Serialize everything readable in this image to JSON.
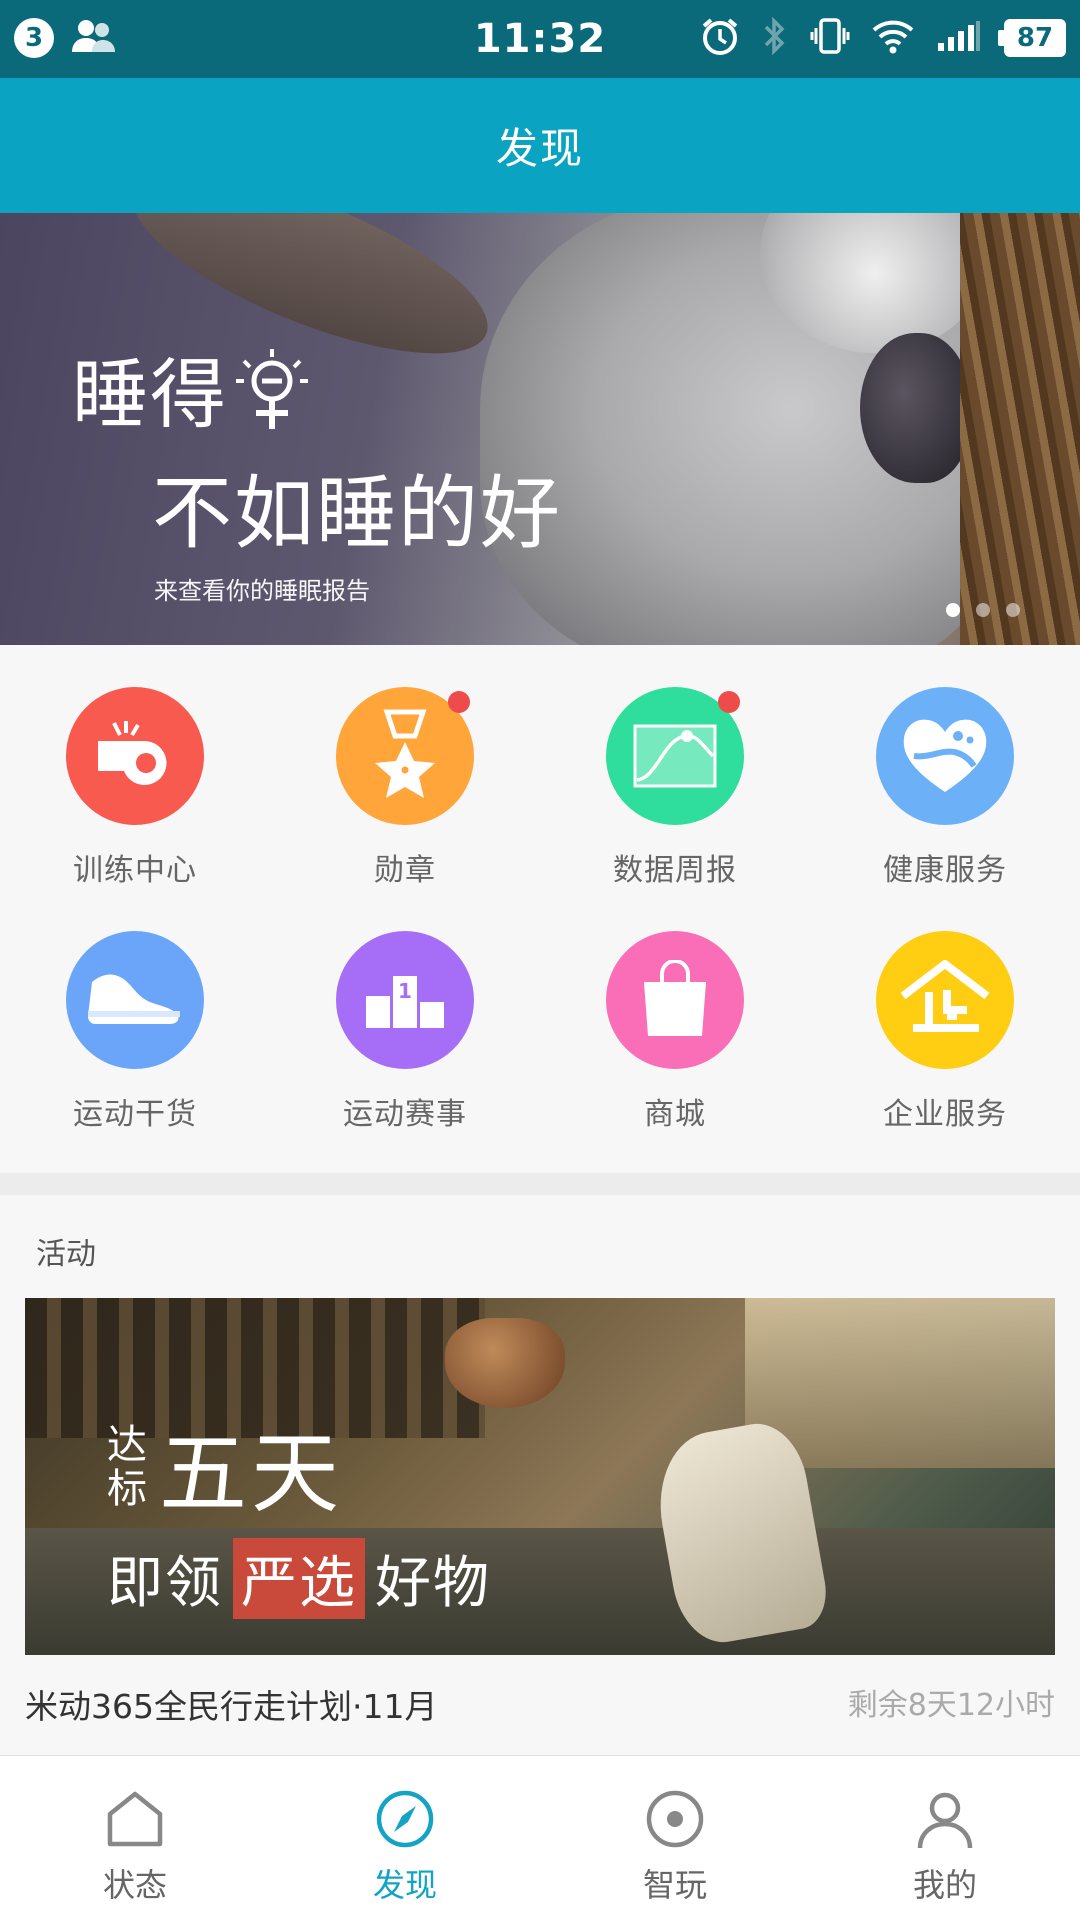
{
  "status_bar": {
    "notification_count": "3",
    "time": "11:32",
    "battery": "87",
    "icons": [
      "contacts-icon",
      "alarm-icon",
      "bluetooth-icon",
      "vibrate-icon",
      "wifi-icon",
      "signal-icon",
      "battery-icon"
    ]
  },
  "header": {
    "title": "发现"
  },
  "banner": {
    "line1": "睡得早",
    "line1_text": "睡得",
    "line2": "不如睡的好",
    "subtitle": "来查看你的睡眠报告",
    "page_count": 3,
    "active_page": 0
  },
  "grid": {
    "items": [
      {
        "label": "训练中心",
        "icon": "whistle-icon",
        "color": "#f85a4f",
        "badge": false
      },
      {
        "label": "勋章",
        "icon": "medal-icon",
        "color": "#ffa53a",
        "badge": true
      },
      {
        "label": "数据周报",
        "icon": "chart-icon",
        "color": "#2fdd9c",
        "badge": true
      },
      {
        "label": "健康服务",
        "icon": "heart-icon",
        "color": "#6cb1f7",
        "badge": false
      },
      {
        "label": "运动干货",
        "icon": "shoe-icon",
        "color": "#6aa5fa",
        "badge": false
      },
      {
        "label": "运动赛事",
        "icon": "podium-icon",
        "color": "#a66ef7",
        "badge": false
      },
      {
        "label": "商城",
        "icon": "shopping-bag-icon",
        "color": "#fa6eb7",
        "badge": false
      },
      {
        "label": "企业服务",
        "icon": "enterprise-icon",
        "color": "#ffcd12",
        "badge": false
      }
    ],
    "badge_color": "#ee4b4b"
  },
  "activity": {
    "section_title": "活动",
    "promo_small_top": "达",
    "promo_small_bottom": "标",
    "promo_big": "五天",
    "promo_line2_a": "即领",
    "promo_line2_hl": "严选",
    "promo_line2_b": "好物",
    "name": "米动365全民行走计划·11月",
    "remaining": "剩余8天12小时"
  },
  "bottom_nav": {
    "items": [
      {
        "label": "状态",
        "icon": "home-icon",
        "active": false
      },
      {
        "label": "发现",
        "icon": "compass-icon",
        "active": true
      },
      {
        "label": "智玩",
        "icon": "radio-target-icon",
        "active": false
      },
      {
        "label": "我的",
        "icon": "person-icon",
        "active": false
      }
    ],
    "active_color": "#14a3c3",
    "inactive_color": "#888888"
  },
  "colors": {
    "status_bar": "#0b6a79",
    "title_bar": "#0aa3c1"
  }
}
